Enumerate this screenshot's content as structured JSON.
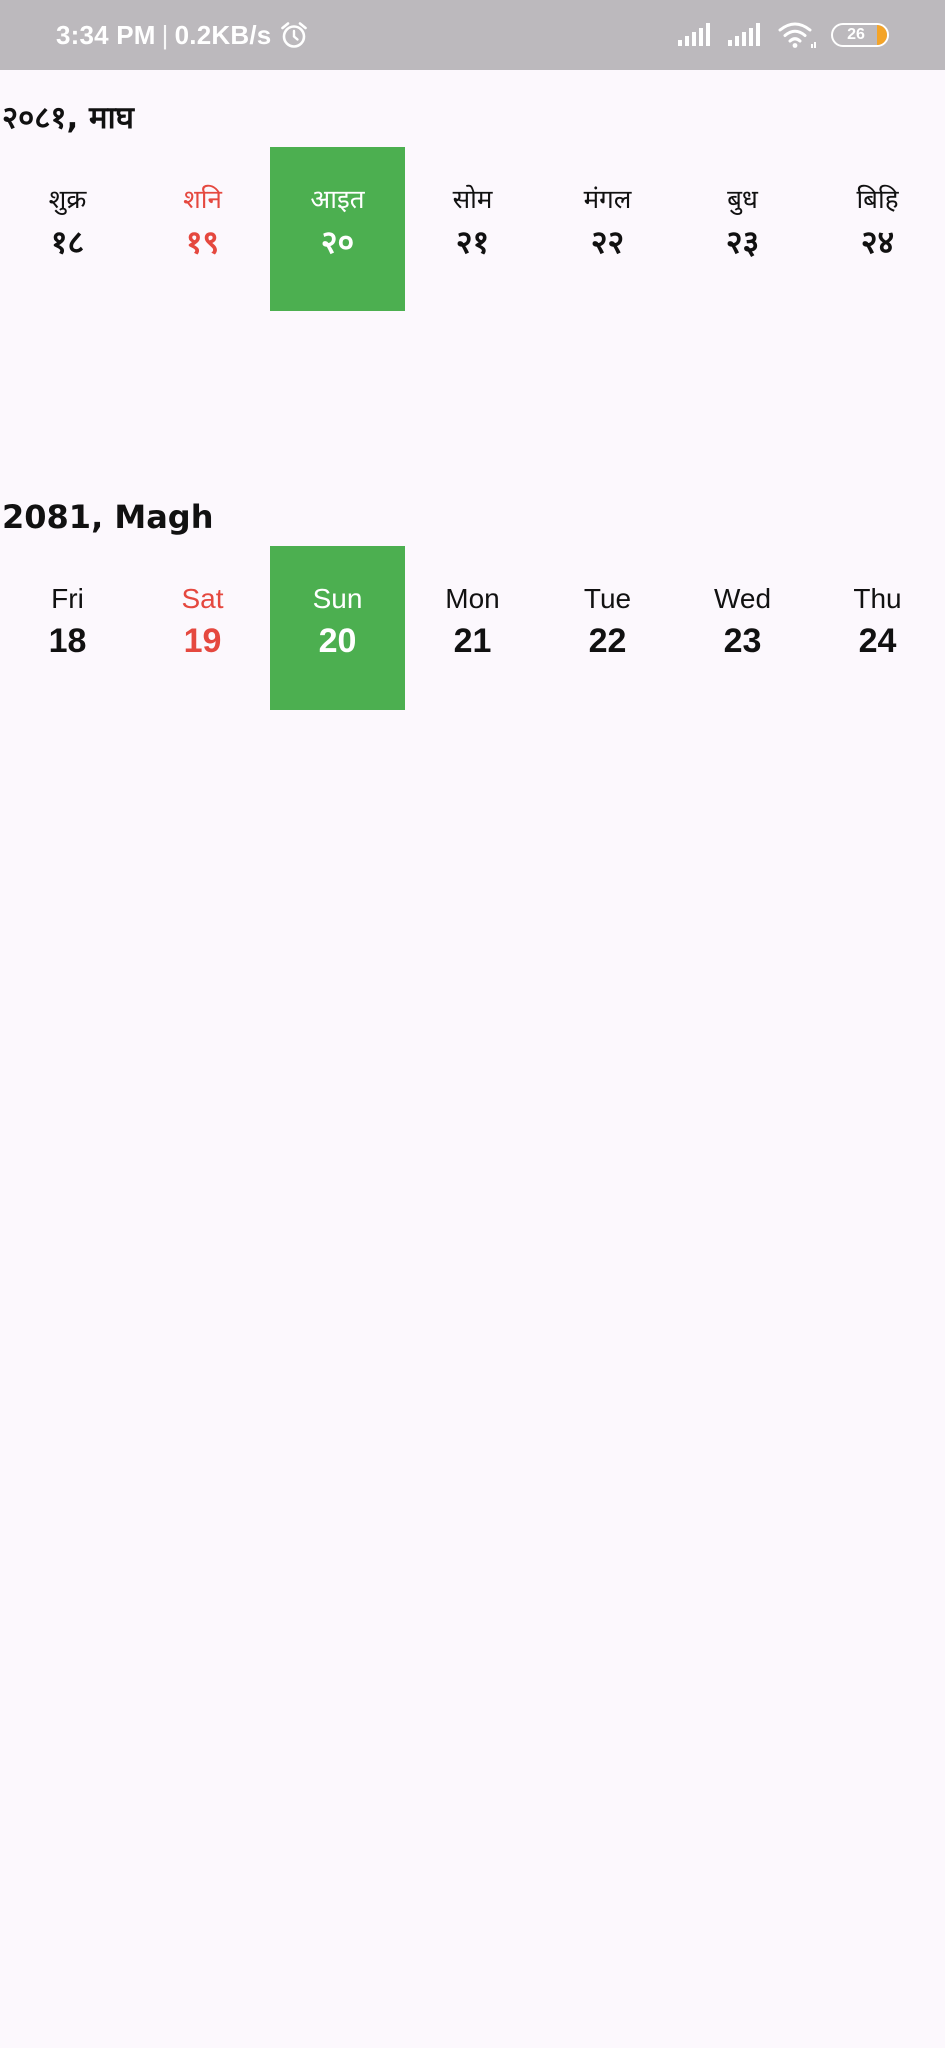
{
  "status_bar": {
    "time": "3:34 PM",
    "separator": "|",
    "network_speed": "0.2KB/s",
    "battery_level": "26",
    "icons": [
      "alarm-icon",
      "signal-icon",
      "signal-icon",
      "wifi-icon",
      "battery-icon"
    ]
  },
  "nepali_calendar": {
    "title": "२०८१, माघ",
    "days": [
      {
        "name": "शुक्र",
        "date": "१८"
      },
      {
        "name": "शनि",
        "date": "१९"
      },
      {
        "name": "आइत",
        "date": "२०"
      },
      {
        "name": "सोम",
        "date": "२१"
      },
      {
        "name": "मंगल",
        "date": "२२"
      },
      {
        "name": "बुध",
        "date": "२३"
      },
      {
        "name": "बिहि",
        "date": "२४"
      }
    ]
  },
  "english_calendar": {
    "title": "2081, Magh",
    "days": [
      {
        "name": "Fri",
        "date": "18"
      },
      {
        "name": "Sat",
        "date": "19"
      },
      {
        "name": "Sun",
        "date": "20"
      },
      {
        "name": "Mon",
        "date": "21"
      },
      {
        "name": "Tue",
        "date": "22"
      },
      {
        "name": "Wed",
        "date": "23"
      },
      {
        "name": "Thu",
        "date": "24"
      }
    ]
  },
  "colors": {
    "selected_background": "#4caf50",
    "weekend_text": "#e5483f",
    "status_bar_background": "#bcb9bd",
    "page_background": "#fcf8fd"
  }
}
